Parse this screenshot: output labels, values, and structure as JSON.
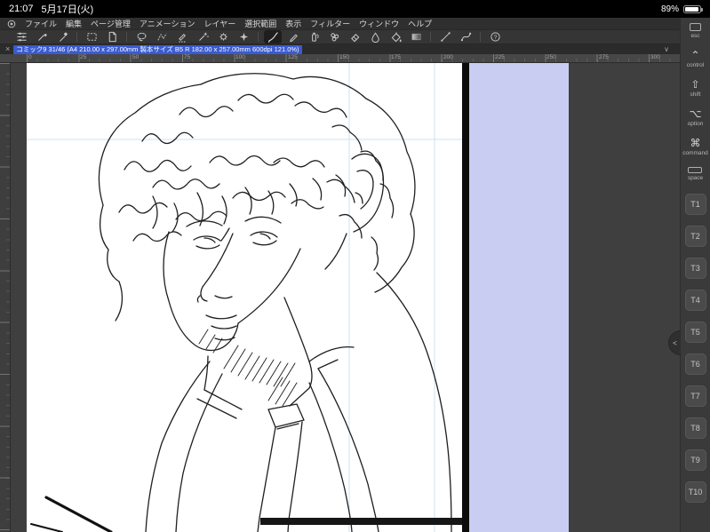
{
  "status_bar": {
    "time": "21:07",
    "date": "5月17日(火)",
    "battery_percent": "89%"
  },
  "menu_bar": {
    "items": [
      "ファイル",
      "編集",
      "ページ管理",
      "アニメーション",
      "レイヤー",
      "選択範囲",
      "表示",
      "フィルター",
      "ウィンドウ",
      "ヘルプ"
    ]
  },
  "toolbar": {
    "tools": [
      "tool-property",
      "pen",
      "marker",
      "marquee-select",
      "page",
      "lasso-select",
      "polyline-select",
      "selection-pen",
      "auto-select",
      "settings-gear",
      "effect-sparkle",
      "brush-active",
      "pencil",
      "airbrush",
      "decoration",
      "eraser",
      "blend",
      "fill",
      "gradient",
      "straight-line",
      "curve",
      "help"
    ]
  },
  "document_tab": {
    "close_label": "×",
    "title": "コミック9 31/46 (A4 210.00 x 297.00mm 製本サイズ B5 R 182.00 x 257.00mm 600dpi 121.0%)",
    "collapse_icon": "∨"
  },
  "ruler": {
    "labels": [
      "0",
      "25",
      "50",
      "75",
      "100",
      "125",
      "150",
      "175",
      "200",
      "225",
      "250",
      "275",
      "300"
    ]
  },
  "edge_keyboard": {
    "keys": [
      {
        "label": "esc",
        "symbol": ""
      },
      {
        "label": "control",
        "symbol": "⌃"
      },
      {
        "label": "shift",
        "symbol": "⇧"
      },
      {
        "label": "option",
        "symbol": "⌥"
      },
      {
        "label": "command",
        "symbol": "⌘"
      },
      {
        "label": "space",
        "symbol": ""
      }
    ],
    "tool_keys": [
      "T1",
      "T2",
      "T3",
      "T4",
      "T5",
      "T6",
      "T7",
      "T8",
      "T9",
      "T10"
    ],
    "collapse_handle": "<"
  },
  "colors": {
    "selection_highlight": "#3b5bd0",
    "margin_area": "#c9cdf2",
    "pasteboard": "#3f3f3f"
  }
}
